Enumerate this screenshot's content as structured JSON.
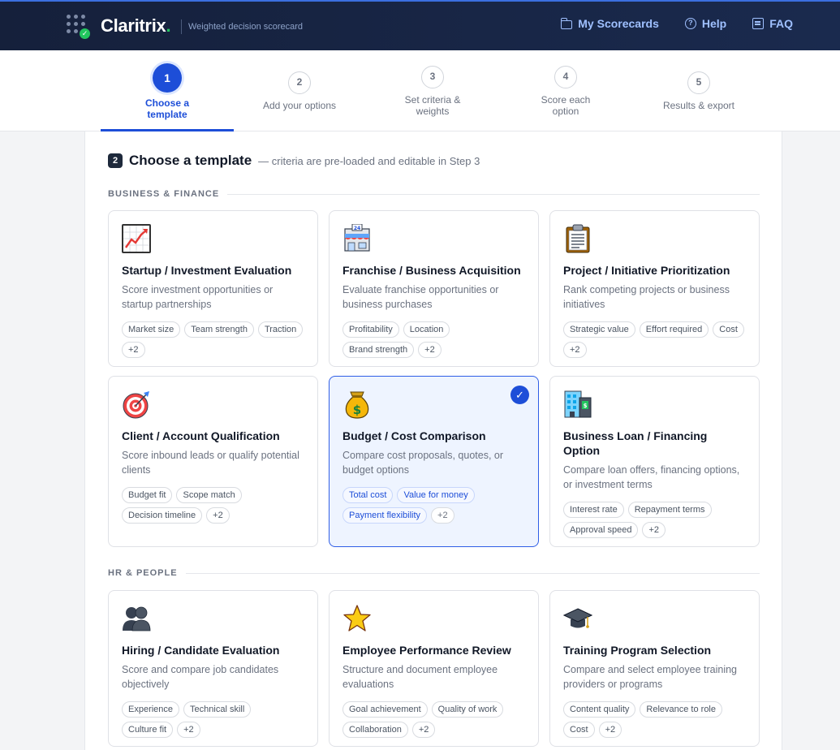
{
  "header": {
    "brand": "Claritrix",
    "brand_dot": ".",
    "tagline": "Weighted decision scorecard",
    "nav": [
      {
        "label": "My Scorecards",
        "icon": "folder-icon"
      },
      {
        "label": "Help",
        "icon": "help-icon"
      },
      {
        "label": "FAQ",
        "icon": "faq-icon"
      }
    ]
  },
  "steps": [
    {
      "num": "1",
      "label": "Choose a template",
      "active": true
    },
    {
      "num": "2",
      "label": "Add your options"
    },
    {
      "num": "3",
      "label": "Set criteria & weights"
    },
    {
      "num": "4",
      "label": "Score each option"
    },
    {
      "num": "5",
      "label": "Results & export"
    }
  ],
  "section": {
    "badge": "2",
    "title": "Choose a template",
    "subtitle": "— criteria are pre-loaded and editable in Step 3"
  },
  "categories": [
    {
      "name": "BUSINESS & FINANCE",
      "cards": [
        {
          "icon": "chart-icon",
          "title": "Startup / Investment Evaluation",
          "desc": "Score investment opportunities or startup partnerships",
          "tags": [
            "Market size",
            "Team strength",
            "Traction",
            "+2"
          ]
        },
        {
          "icon": "store-icon",
          "title": "Franchise / Business Acquisition",
          "desc": "Evaluate franchise opportunities or business purchases",
          "tags": [
            "Profitability",
            "Location",
            "Brand strength",
            "+2"
          ]
        },
        {
          "icon": "clipboard-icon",
          "title": "Project / Initiative Prioritization",
          "desc": "Rank competing projects or business initiatives",
          "tags": [
            "Strategic value",
            "Effort required",
            "Cost",
            "+2"
          ]
        },
        {
          "icon": "target-icon",
          "title": "Client / Account Qualification",
          "desc": "Score inbound leads or qualify potential clients",
          "tags": [
            "Budget fit",
            "Scope match",
            "Decision timeline",
            "+2"
          ]
        },
        {
          "icon": "money-bag-icon",
          "title": "Budget / Cost Comparison",
          "desc": "Compare cost proposals, quotes, or budget options",
          "tags": [
            "Total cost",
            "Value for money",
            "Payment flexibility",
            "+2"
          ],
          "selected": true
        },
        {
          "icon": "bank-building-icon",
          "title": "Business Loan / Financing Option",
          "desc": "Compare loan offers, financing options, or investment terms",
          "tags": [
            "Interest rate",
            "Repayment terms",
            "Approval speed",
            "+2"
          ]
        }
      ]
    },
    {
      "name": "HR & PEOPLE",
      "cards": [
        {
          "icon": "people-icon",
          "title": "Hiring / Candidate Evaluation",
          "desc": "Score and compare job candidates objectively",
          "tags": [
            "Experience",
            "Technical skill",
            "Culture fit",
            "+2"
          ]
        },
        {
          "icon": "star-icon",
          "title": "Employee Performance Review",
          "desc": "Structure and document employee evaluations",
          "tags": [
            "Goal achievement",
            "Quality of work",
            "Collaboration",
            "+2"
          ]
        },
        {
          "icon": "graduation-cap-icon",
          "title": "Training Program Selection",
          "desc": "Compare and select employee training providers or programs",
          "tags": [
            "Content quality",
            "Relevance to role",
            "Cost",
            "+2"
          ]
        }
      ]
    }
  ],
  "colors": {
    "header_bg": "#15203b",
    "accent": "#1d4ed8",
    "success": "#22c55e"
  }
}
